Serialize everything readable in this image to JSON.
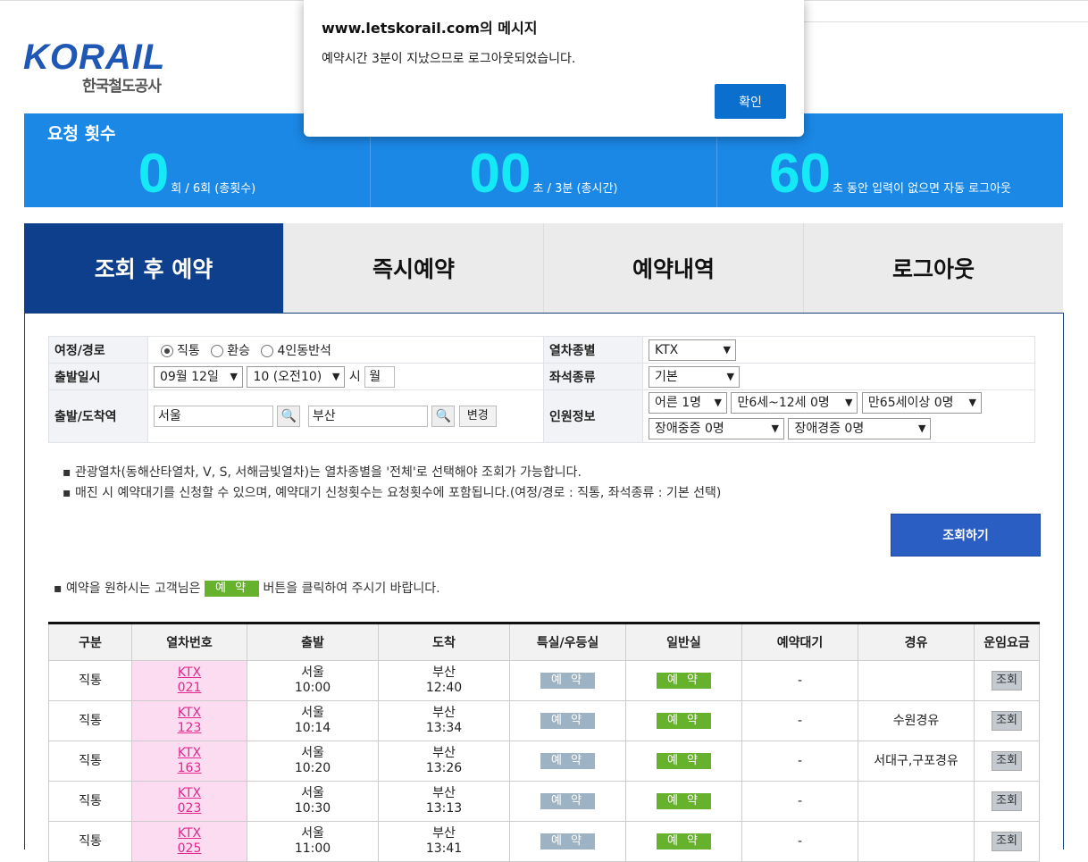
{
  "logo": {
    "brand": "KORAIL",
    "sub": "한국철도공사"
  },
  "stats": [
    {
      "label": "요청 횟수",
      "big": "0",
      "small": "회 / 6회 (총횟수)"
    },
    {
      "label": "",
      "big": "00",
      "small": "초 / 3분 (총시간)"
    },
    {
      "label": "",
      "big": "60",
      "small": "초 동안 입력이 없으면 자동 로그아웃"
    }
  ],
  "tabs": [
    "조회 후 예약",
    "즉시예약",
    "예약내역",
    "로그아웃"
  ],
  "form": {
    "route_label": "여정/경로",
    "route_opts": [
      "직통",
      "환승",
      "4인동반석"
    ],
    "train_type_label": "열차종별",
    "train_type": "KTX",
    "depart_label": "출발일시",
    "date": "09월 12일",
    "time": "10 (오전10)",
    "hour_unit": "시",
    "weekday": "월",
    "seat_label": "좌석종류",
    "seat": "기본",
    "station_label": "출발/도착역",
    "from": "서울",
    "to": "부산",
    "change_btn": "변경",
    "people_label": "인원정보",
    "people": [
      "어른 1명",
      "만6세~12세 0명",
      "만65세이상 0명",
      "장애중증 0명",
      "장애경증 0명"
    ]
  },
  "notes": [
    "관광열차(동해산타열차, V, S, 서해금빛열차)는 열차종별을 '전체'로 선택해야 조회가 가능합니다.",
    "매진 시 예약대기를 신청할 수 있으며, 예약대기 신청횟수는 요청횟수에 포함됩니다.(여정/경로 : 직통, 좌석종류 : 기본 선택)"
  ],
  "search_btn": "조회하기",
  "hint": {
    "pre": "예약을 원하시는 고객님은",
    "btn": "예 약",
    "post": "버튼을 클릭하여 주시기 바랍니다."
  },
  "table": {
    "headers": [
      "구분",
      "열차번호",
      "출발",
      "도착",
      "특실/우등실",
      "일반실",
      "예약대기",
      "경유",
      "운임요금"
    ],
    "rows": [
      {
        "kind": "직통",
        "type": "KTX",
        "no": "021",
        "dep": "서울",
        "dep_t": "10:00",
        "arr": "부산",
        "arr_t": "12:40",
        "first": "예 약",
        "normal": "예 약",
        "wait": "-",
        "via": "",
        "fare": "조회"
      },
      {
        "kind": "직통",
        "type": "KTX",
        "no": "123",
        "dep": "서울",
        "dep_t": "10:14",
        "arr": "부산",
        "arr_t": "13:34",
        "first": "예 약",
        "normal": "예 약",
        "wait": "-",
        "via": "수원경유",
        "fare": "조회"
      },
      {
        "kind": "직통",
        "type": "KTX",
        "no": "163",
        "dep": "서울",
        "dep_t": "10:20",
        "arr": "부산",
        "arr_t": "13:26",
        "first": "예 약",
        "normal": "예 약",
        "wait": "-",
        "via": "서대구,구포경유",
        "fare": "조회"
      },
      {
        "kind": "직통",
        "type": "KTX",
        "no": "023",
        "dep": "서울",
        "dep_t": "10:30",
        "arr": "부산",
        "arr_t": "13:13",
        "first": "예 약",
        "normal": "예 약",
        "wait": "-",
        "via": "",
        "fare": "조회"
      },
      {
        "kind": "직통",
        "type": "KTX",
        "no": "025",
        "dep": "서울",
        "dep_t": "11:00",
        "arr": "부산",
        "arr_t": "13:41",
        "first": "예 약",
        "normal": "예 약",
        "wait": "-",
        "via": "",
        "fare": "조회"
      }
    ]
  },
  "dialog": {
    "title": "www.letskorail.com의 메시지",
    "message": "예약시간 3분이 지났으므로 로그아웃되었습니다.",
    "ok": "확인"
  }
}
